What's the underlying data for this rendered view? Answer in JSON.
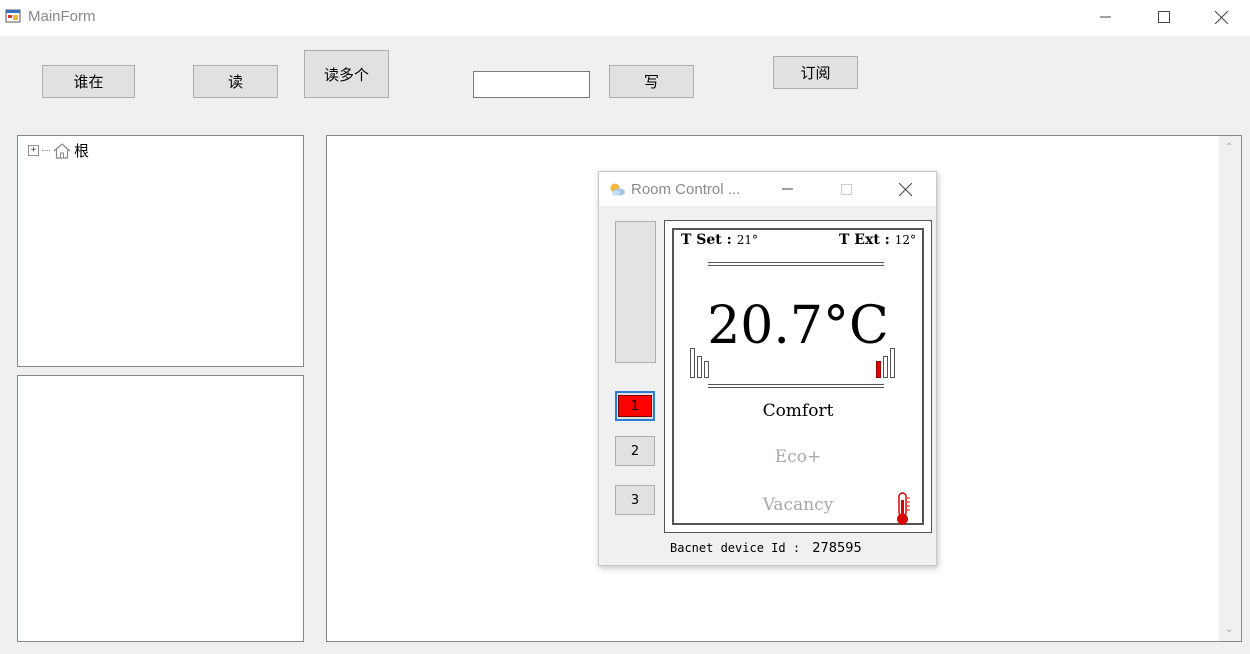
{
  "window": {
    "title": "MainForm"
  },
  "toolbar": {
    "who_is": "谁在",
    "read": "读",
    "read_multiple": "读多个",
    "write_value": "",
    "write": "写",
    "subscribe": "订阅"
  },
  "tree": {
    "root_label": "根",
    "expander": "+"
  },
  "room_control": {
    "title": "Room Control ...",
    "t_set_label": "T Set :",
    "t_set_value": "21°",
    "t_ext_label": "T Ext :",
    "t_ext_value": "12°",
    "temperature": "20.7°C",
    "modes": [
      "Comfort",
      "Eco+",
      "Vacancy"
    ],
    "buttons": [
      "1",
      "2",
      "3"
    ],
    "active_button": "1",
    "device_id_label": "Bacnet device Id :",
    "device_id": "278595"
  },
  "icons": {
    "app": "app-form-icon",
    "minimize": "minimize-icon",
    "maximize": "maximize-icon",
    "close": "close-icon",
    "tree_root": "house-icon",
    "room_control": "weather-sun-cloud-icon",
    "thermometer": "thermometer-icon"
  },
  "colors": {
    "accent_red": "#ff0000",
    "focus_blue": "#2a7fd4",
    "dim_text": "#a8a8a8"
  }
}
